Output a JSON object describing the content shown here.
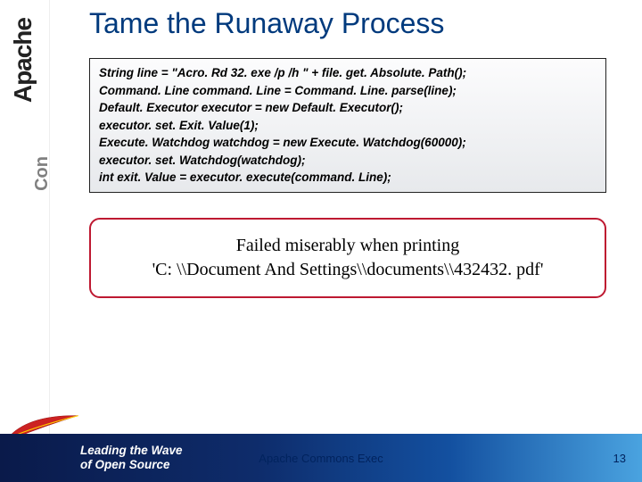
{
  "sidebar": {
    "brand_main": "Apache",
    "brand_sub": "Con"
  },
  "slide": {
    "title": "Tame the Runaway Process",
    "code_lines": [
      "String line = \"Acro. Rd 32. exe /p /h \" + file. get. Absolute. Path();",
      "Command. Line command. Line = Command. Line. parse(line);",
      "Default. Executor executor = new Default. Executor();",
      "executor. set. Exit. Value(1);",
      "Execute. Watchdog watchdog = new Execute. Watchdog(60000);",
      "executor. set. Watchdog(watchdog);",
      "int exit. Value = executor. execute(command. Line);"
    ],
    "callout_line1": "Failed miserably when printing",
    "callout_line2": "'C: \\\\Document And Settings\\\\documents\\\\432432. pdf'"
  },
  "footer": {
    "tagline_line1": "Leading the Wave",
    "tagline_line2": "of Open Source",
    "center": "Apache Commons Exec",
    "page": "13"
  }
}
